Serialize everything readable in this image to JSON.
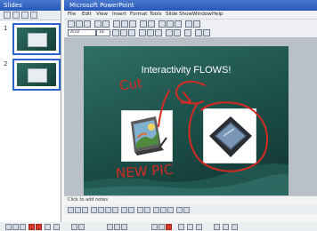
{
  "left_panel": {
    "title": "Slides",
    "slides": [
      {
        "number": "1"
      },
      {
        "number": "2"
      }
    ]
  },
  "main_window": {
    "title": "Microsoft PowerPoint",
    "menu": [
      "File",
      "Edit",
      "View",
      "Insert",
      "Format",
      "Tools",
      "Slide Show",
      "Window",
      "Help"
    ],
    "format_dropdowns": {
      "font": "Arial",
      "size": "18"
    }
  },
  "slide": {
    "title": "Interactivity FLOWS!",
    "ink_annotations": {
      "top": "Cut",
      "bottom": "NEW PIC"
    },
    "ink_color": "#d42a22",
    "images": [
      "tablet-pc-illustration",
      "tablet-device-photo"
    ]
  },
  "notes": {
    "placeholder": "Click to add notes"
  },
  "colors": {
    "slide_bg": "#1f5852",
    "titlebar": "#2f62c4",
    "ink": "#d42a22"
  }
}
